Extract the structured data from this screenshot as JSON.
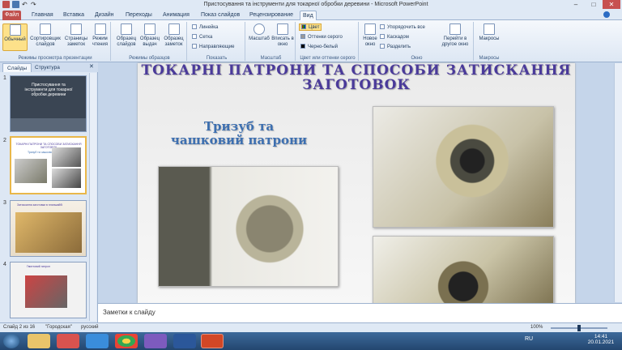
{
  "window": {
    "title": "Пристосування та інструменти для токарної обробки деревини - Microsoft PowerPoint",
    "min": "–",
    "max": "□",
    "close": "✕"
  },
  "tabs": [
    "Файл",
    "Главная",
    "Вставка",
    "Дизайн",
    "Переходы",
    "Анимация",
    "Показ слайдов",
    "Рецензирование",
    "Вид"
  ],
  "ribbon": {
    "views": {
      "label": "Режимы просмотра презентации",
      "buttons": [
        "Обычный",
        "Сортировщик слайдов",
        "Страницы заметок",
        "Режим чтения"
      ]
    },
    "masters": {
      "label": "Режимы образцов",
      "buttons": [
        "Образец слайдов",
        "Образец выдач",
        "Образец заметок"
      ]
    },
    "show": {
      "label": "Показать",
      "items": [
        "Линейка",
        "Сетка",
        "Направляющие"
      ]
    },
    "zoom": {
      "label": "Масштаб",
      "buttons": [
        "Масштаб",
        "Вписать в окно"
      ]
    },
    "color": {
      "label": "Цвет или оттенки серого",
      "items": [
        "Цвет",
        "Оттенки серого",
        "Черно-белый"
      ]
    },
    "window": {
      "label": "Окно",
      "new": "Новое окно",
      "items": [
        "Упорядочить все",
        "Каскадом",
        "Разделить"
      ],
      "switch": "Перейти в другое окно"
    },
    "macros": {
      "label": "Макросы",
      "btn": "Макросы"
    }
  },
  "pane": {
    "tabs": [
      "Слайды",
      "Структура"
    ],
    "close": "✕"
  },
  "thumbs": [
    {
      "num": "1",
      "title": "Пристосування та інструменти для токарної обробки деревини"
    },
    {
      "num": "2",
      "title": "ТОКАРНІ ПАТРОНИ ТА СПОСОБИ ЗАТИСКАННЯ ЗАГОТОВОК",
      "sub": "Тризуб та чашковий патрони"
    },
    {
      "num": "3",
      "title": "Затискання заготовки в планшайбі"
    },
    {
      "num": "4",
      "title": "Гвинтовий патрон"
    }
  ],
  "slide": {
    "title_line1": "ТОКАРНІ ПАТРОНИ ТА СПОСОБИ ЗАТИСКАННЯ",
    "title_line2": "ЗАГОТОВОК",
    "subtitle_line1": "Тризуб та",
    "subtitle_line2": "чашковий патрони"
  },
  "notes": {
    "placeholder": "Заметки к слайду"
  },
  "status": {
    "slide": "Слайд 2 из 16",
    "theme": "\"Городская\"",
    "lang": "русский",
    "zoom": "100%"
  },
  "taskbar": {
    "lang": "RU",
    "time": "14:41",
    "date": "20.01.2021"
  },
  "colors": {
    "file_tab": "#c0504d",
    "title_text": "#4a3a9a",
    "subtitle": "#3d6fb0",
    "taskbar": "#23466f"
  }
}
